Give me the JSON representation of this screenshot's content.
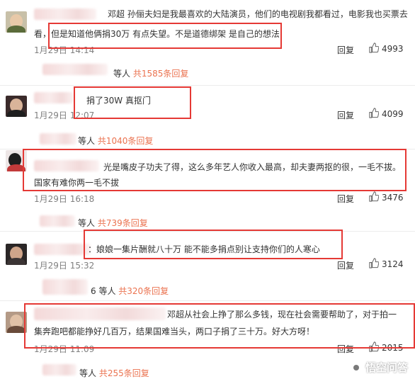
{
  "colors": {
    "highlight_box": "#e53935",
    "link_count": "#eb7350",
    "meta_gray": "#808080"
  },
  "comments": [
    {
      "user": "邓超",
      "line1": "孙俪夫妇是我最喜欢的大陆演员，他们的电视剧我都看过，电影我也买票去",
      "line2": "看，但是知道他俩捐30万 有点失望。不是道德绑架 是自己的想法",
      "time": "1月29日 14:14",
      "reply": "回复",
      "likes": "4993",
      "sub_prefix": "等人",
      "sub_count": "共1585条回复"
    },
    {
      "line1": "捐了30W 真抠门",
      "time": "1月29日 12:07",
      "reply": "回复",
      "likes": "4099",
      "sub_prefix": "等人",
      "sub_count": "共1040条回复"
    },
    {
      "line1": "光是嘴皮子功夫了得，这么多年艺人你收入最高，却夫妻两抠的很，一毛不拔。",
      "line2": "国家有难你两一毛不拔",
      "time": "1月29日 16:18",
      "reply": "回复",
      "likes": "3476",
      "sub_prefix": "等人",
      "sub_count": "共739条回复"
    },
    {
      "line1": "：娘娘一集片酬就八十万 能不能多捐点别让支持你们的人寒心",
      "time": "1月29日 15:32",
      "reply": "回复",
      "likes": "3124",
      "sub_prefix": "6 等人",
      "sub_count": "共320条回复"
    },
    {
      "line1": "邓超从社会上挣了那么多钱，现在社会需要帮助了，对于拍一",
      "line2": "集奔跑吧都能挣好几百万，结果国难当头，两口子捐了三十万。好大方呀！",
      "time": "1月29日 11:09",
      "reply": "回复",
      "likes": "2015",
      "sub_prefix": "等人",
      "sub_count": "共255条回复"
    }
  ],
  "watermark": {
    "icon": "wukong-logo-icon",
    "text": "悟空问答"
  },
  "icons": {
    "like": "thumbs-up-icon"
  }
}
